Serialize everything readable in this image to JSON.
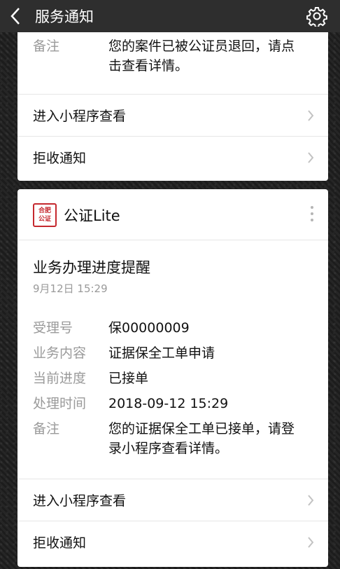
{
  "header": {
    "title": "服务通知",
    "back_icon": "chevron-left-icon",
    "settings_icon": "gear-icon"
  },
  "card1": {
    "remark_label": "备注",
    "remark_value_line1": "您的案件已被公证员退回，请点",
    "remark_value_line2": "击查看详情。",
    "action_view": "进入小程序查看",
    "action_reject": "拒收通知"
  },
  "card2": {
    "app_name": "公证Lite",
    "logo_text": "合肥 公证",
    "heading": "业务办理进度提醒",
    "time": "9月12日 15:29",
    "fields": [
      {
        "label": "受理号",
        "value": "保00000009"
      },
      {
        "label": "业务内容",
        "value": "证据保全工单申请"
      },
      {
        "label": "当前进度",
        "value": "已接单"
      },
      {
        "label": "处理时间",
        "value": "2018-09-12 15:29"
      }
    ],
    "remark_label": "备注",
    "remark_value_line1": "您的证据保全工单已接单，请登",
    "remark_value_line2": "录小程序查看详情。",
    "action_view": "进入小程序查看",
    "action_reject": "拒收通知"
  },
  "colors": {
    "logo_red": "#c5282e",
    "label_gray": "#9a9a9a",
    "topbar": "#2e2e2e"
  }
}
